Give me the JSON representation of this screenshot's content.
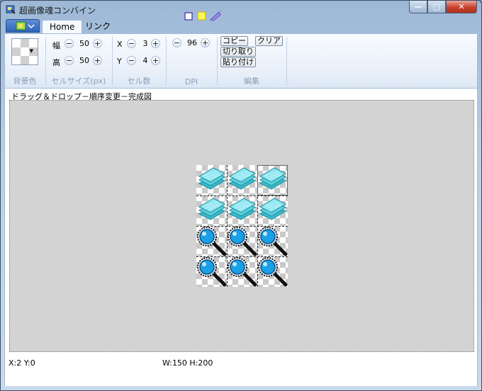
{
  "window": {
    "title": "超画像魂コンバイン"
  },
  "window_buttons": {
    "minimize": "—",
    "maximize": "□",
    "close": "✕"
  },
  "tabs": [
    {
      "label": "Home"
    },
    {
      "label": "リンク"
    }
  ],
  "ribbon": {
    "bg": {
      "label": "背景色"
    },
    "cellsize": {
      "label": "セルサイズ(px)",
      "width_label": "幅",
      "width_value": "50",
      "height_label": "高",
      "height_value": "50"
    },
    "cellcount": {
      "label": "セル数",
      "x_label": "X",
      "x_value": "3",
      "y_label": "Y",
      "y_value": "4"
    },
    "dpi": {
      "label": "DPI",
      "value": "96"
    },
    "edit": {
      "label": "編集",
      "copy": "コピー",
      "clear": "クリア",
      "cut": "切り取り",
      "paste": "貼り付け"
    },
    "minus": "−",
    "plus": "+"
  },
  "canvas": {
    "title": "ドラッグ＆ドロップ－順序変更－完成図",
    "cells": [
      {
        "icon": "blue-layers-icon"
      },
      {
        "icon": "blue-layers-icon"
      },
      {
        "icon": "blue-layers-icon"
      },
      {
        "icon": "blue-layers-icon"
      },
      {
        "icon": "blue-layers-icon"
      },
      {
        "icon": "blue-layers-icon"
      },
      {
        "icon": "magnifier-icon"
      },
      {
        "icon": "magnifier-icon"
      },
      {
        "icon": "magnifier-icon"
      },
      {
        "icon": "magnifier-icon"
      },
      {
        "icon": "magnifier-icon"
      },
      {
        "icon": "magnifier-icon"
      }
    ]
  },
  "status": {
    "position": "X:2 Y:0",
    "size": "W:150 H:200"
  }
}
